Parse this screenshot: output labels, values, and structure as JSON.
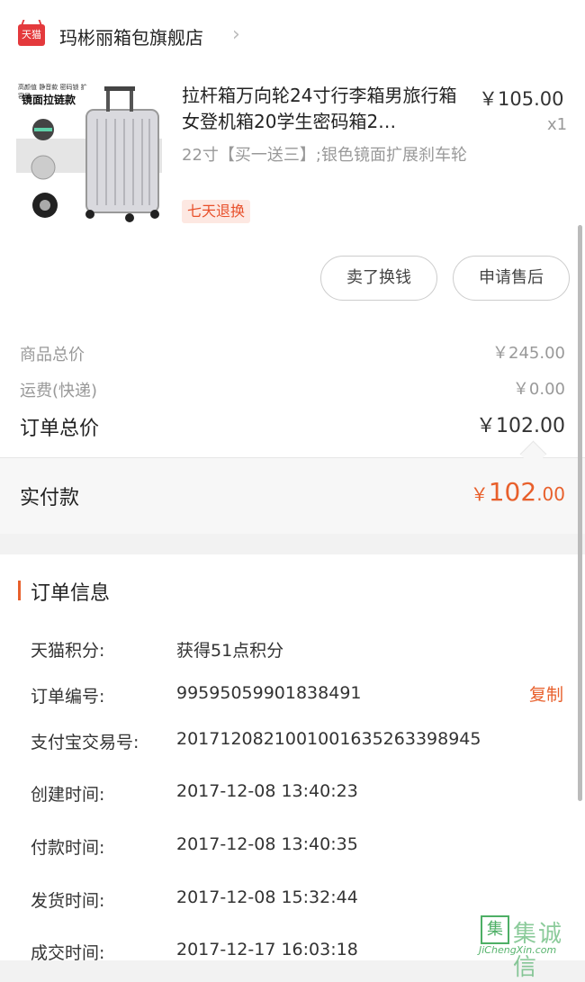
{
  "shop": {
    "icon_text": "天猫",
    "name": "玛彬丽箱包旗舰店",
    "chevron": "›"
  },
  "product": {
    "thumb_text": "镜面拉链款",
    "thumb_small": "高颜值 静音款 密码锁 扩容层",
    "title": "拉杆箱万向轮24寸行李箱男旅行箱女登机箱20学生密码箱2…",
    "price": "￥105.00",
    "qty": "x1",
    "sku": "22寸【买一送三】;银色镜面扩展刹车轮",
    "tag": "七天退换"
  },
  "actions": {
    "sell_label": "卖了换钱",
    "after_sale_label": "申请售后"
  },
  "summary": {
    "goods_total_label": "商品总价",
    "goods_total": "￥245.00",
    "shipping_label": "运费(快递)",
    "shipping": "￥0.00",
    "order_total_label": "订单总价",
    "order_total": "￥102.00"
  },
  "payment": {
    "label": "实付款",
    "currency": "￥",
    "int": "102",
    "dec": ".00"
  },
  "order_info": {
    "title": "订单信息",
    "rows": [
      {
        "label": "天猫积分:",
        "value": "获得51点积分"
      },
      {
        "label": "订单编号:",
        "value": "99595059901838491"
      },
      {
        "label": "支付宝交易号:",
        "value": "2017120821001001635263398945"
      },
      {
        "label": "创建时间:",
        "value": "2017-12-08 13:40:23"
      },
      {
        "label": "付款时间:",
        "value": "2017-12-08 13:40:35"
      },
      {
        "label": "发货时间:",
        "value": "2017-12-08 15:32:44"
      },
      {
        "label": "成交时间:",
        "value": "2017-12-17 16:03:18"
      }
    ],
    "copy_label": "复制"
  },
  "watermark": {
    "cn": "集诚信",
    "en": "JiChengXin.com"
  },
  "colors": {
    "accent": "#e8602c",
    "tmall": "#e4393c"
  }
}
